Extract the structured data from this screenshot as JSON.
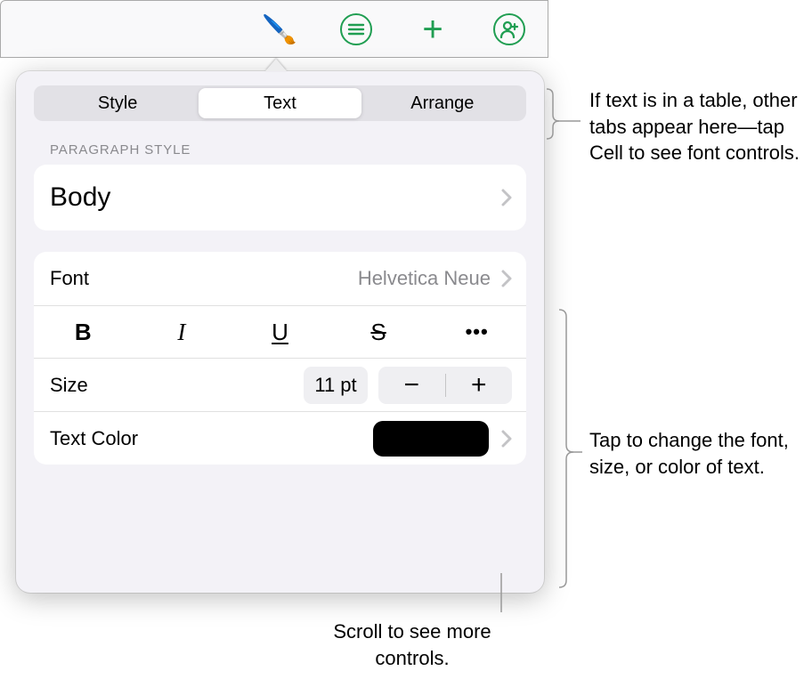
{
  "toolbar": {
    "brush_icon_title": "Format",
    "list_icon_title": "Outline",
    "plus_icon_title": "Insert",
    "collab_icon_title": "Collaborate"
  },
  "tabs": {
    "style": "Style",
    "text": "Text",
    "arrange": "Arrange"
  },
  "section": {
    "paragraph_style_heading": "PARAGRAPH STYLE",
    "paragraph_style_value": "Body"
  },
  "font": {
    "label": "Font",
    "value": "Helvetica Neue"
  },
  "formatting": {
    "bold": "B",
    "italic": "I",
    "underline": "U",
    "strikethrough": "S",
    "more": "•••"
  },
  "size": {
    "label": "Size",
    "value": "11 pt",
    "minus": "−",
    "plus": "+"
  },
  "textcolor": {
    "label": "Text Color",
    "swatch": "#000000"
  },
  "callouts": {
    "c1": "If text is in a table, other tabs appear here—tap Cell to see font controls.",
    "c2": "Tap to change the font, size, or color of text.",
    "c3": "Scroll to see more controls."
  }
}
